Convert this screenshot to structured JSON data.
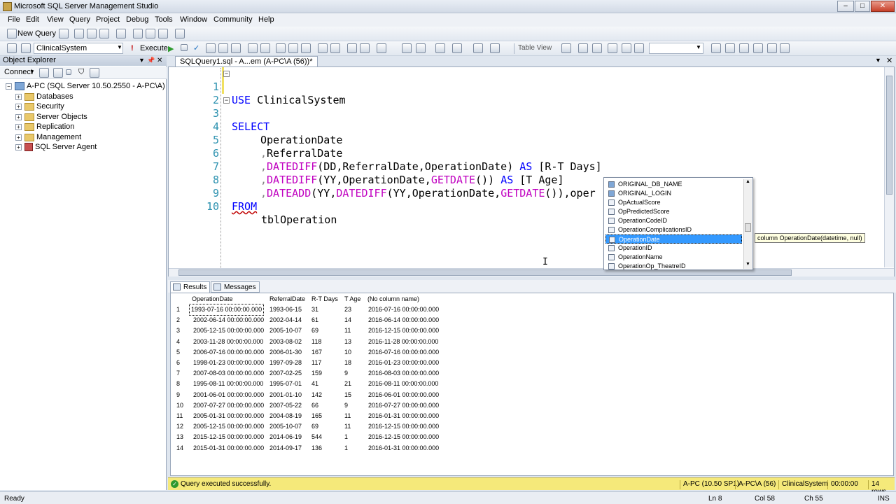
{
  "window": {
    "title": "Microsoft SQL Server Management Studio"
  },
  "menu": [
    "File",
    "Edit",
    "View",
    "Query",
    "Project",
    "Debug",
    "Tools",
    "Window",
    "Community",
    "Help"
  ],
  "toolbar1": {
    "new_query": "New Query"
  },
  "toolbar2": {
    "database": "ClinicalSystem",
    "execute": "Execute",
    "table_view": "Table View"
  },
  "object_explorer": {
    "title": "Object Explorer",
    "connect": "Connect",
    "server": "A-PC (SQL Server 10.50.2550 - A-PC\\A)",
    "nodes": [
      "Databases",
      "Security",
      "Server Objects",
      "Replication",
      "Management",
      "SQL Server Agent"
    ]
  },
  "tab": {
    "title": "SQLQuery1.sql - A...em (A-PC\\A (56))*"
  },
  "code": {
    "line_numbers": [
      "1",
      "2",
      "3",
      "4",
      "5",
      "6",
      "7",
      "8",
      "9",
      "10"
    ],
    "use_kw": "USE",
    "use_db": "ClinicalSystem",
    "select_kw": "SELECT",
    "l4": "OperationDate",
    "l5_comma": ",",
    "l5": "ReferralDate",
    "l6_comma": ",",
    "l6_fn": "DATEDIFF",
    "l6_args": "(DD,ReferralDate,OperationDate)",
    "l6_as": "AS",
    "l6_alias": "[R-T Days]",
    "l7_comma": ",",
    "l7_fn": "DATEDIFF",
    "l7_a1": "(YY,OperationDate,",
    "l7_fn2": "GETDATE",
    "l7_a2": "())",
    "l7_as": "AS",
    "l7_alias": "[T Age]",
    "l8_comma": ",",
    "l8_fn": "DATEADD",
    "l8_a1": "(YY,",
    "l8_fn2": "DATEDIFF",
    "l8_a2": "(YY,OperationDate,",
    "l8_fn3": "GETDATE",
    "l8_a3": "()),oper",
    "from_kw": "FROM",
    "l10": "tblOperation"
  },
  "intellisense": {
    "items": [
      "ORIGINAL_DB_NAME",
      "ORIGINAL_LOGIN",
      "OpActualScore",
      "OpPredictedScore",
      "OperationCodeID",
      "OperationComplicationsID",
      "OperationDate",
      "OperationID",
      "OperationName",
      "OperationOp_TheatreID"
    ],
    "selected_index": 6,
    "tooltip": "column OperationDate(datetime, null)"
  },
  "results_tabs": {
    "results": "Results",
    "messages": "Messages"
  },
  "results": {
    "columns": [
      "OperationDate",
      "ReferralDate",
      "R-T Days",
      "T Age",
      "(No column name)"
    ],
    "rows": [
      [
        "1",
        "1993-07-16 00:00:00.000",
        "1993-06-15",
        "31",
        "23",
        "2016-07-16 00:00:00.000"
      ],
      [
        "2",
        "2002-06-14 00:00:00.000",
        "2002-04-14",
        "61",
        "14",
        "2016-06-14 00:00:00.000"
      ],
      [
        "3",
        "2005-12-15 00:00:00.000",
        "2005-10-07",
        "69",
        "11",
        "2016-12-15 00:00:00.000"
      ],
      [
        "4",
        "2003-11-28 00:00:00.000",
        "2003-08-02",
        "118",
        "13",
        "2016-11-28 00:00:00.000"
      ],
      [
        "5",
        "2006-07-16 00:00:00.000",
        "2006-01-30",
        "167",
        "10",
        "2016-07-16 00:00:00.000"
      ],
      [
        "6",
        "1998-01-23 00:00:00.000",
        "1997-09-28",
        "117",
        "18",
        "2016-01-23 00:00:00.000"
      ],
      [
        "7",
        "2007-08-03 00:00:00.000",
        "2007-02-25",
        "159",
        "9",
        "2016-08-03 00:00:00.000"
      ],
      [
        "8",
        "1995-08-11 00:00:00.000",
        "1995-07-01",
        "41",
        "21",
        "2016-08-11 00:00:00.000"
      ],
      [
        "9",
        "2001-06-01 00:00:00.000",
        "2001-01-10",
        "142",
        "15",
        "2016-06-01 00:00:00.000"
      ],
      [
        "10",
        "2007-07-27 00:00:00.000",
        "2007-05-22",
        "66",
        "9",
        "2016-07-27 00:00:00.000"
      ],
      [
        "11",
        "2005-01-31 00:00:00.000",
        "2004-08-19",
        "165",
        "11",
        "2016-01-31 00:00:00.000"
      ],
      [
        "12",
        "2005-12-15 00:00:00.000",
        "2005-10-07",
        "69",
        "11",
        "2016-12-15 00:00:00.000"
      ],
      [
        "13",
        "2015-12-15 00:00:00.000",
        "2014-06-19",
        "544",
        "1",
        "2016-12-15 00:00:00.000"
      ],
      [
        "14",
        "2015-01-31 00:00:00.000",
        "2014-09-17",
        "136",
        "1",
        "2016-01-31 00:00:00.000"
      ]
    ]
  },
  "query_status": {
    "message": "Query executed successfully.",
    "server": "A-PC (10.50 SP1)",
    "user": "A-PC\\A (56)",
    "db": "ClinicalSystem",
    "time": "00:00:00",
    "rows": "14 rows"
  },
  "statusbar": {
    "ready": "Ready",
    "ln": "Ln 8",
    "col": "Col 58",
    "ch": "Ch 55",
    "ins": "INS"
  }
}
